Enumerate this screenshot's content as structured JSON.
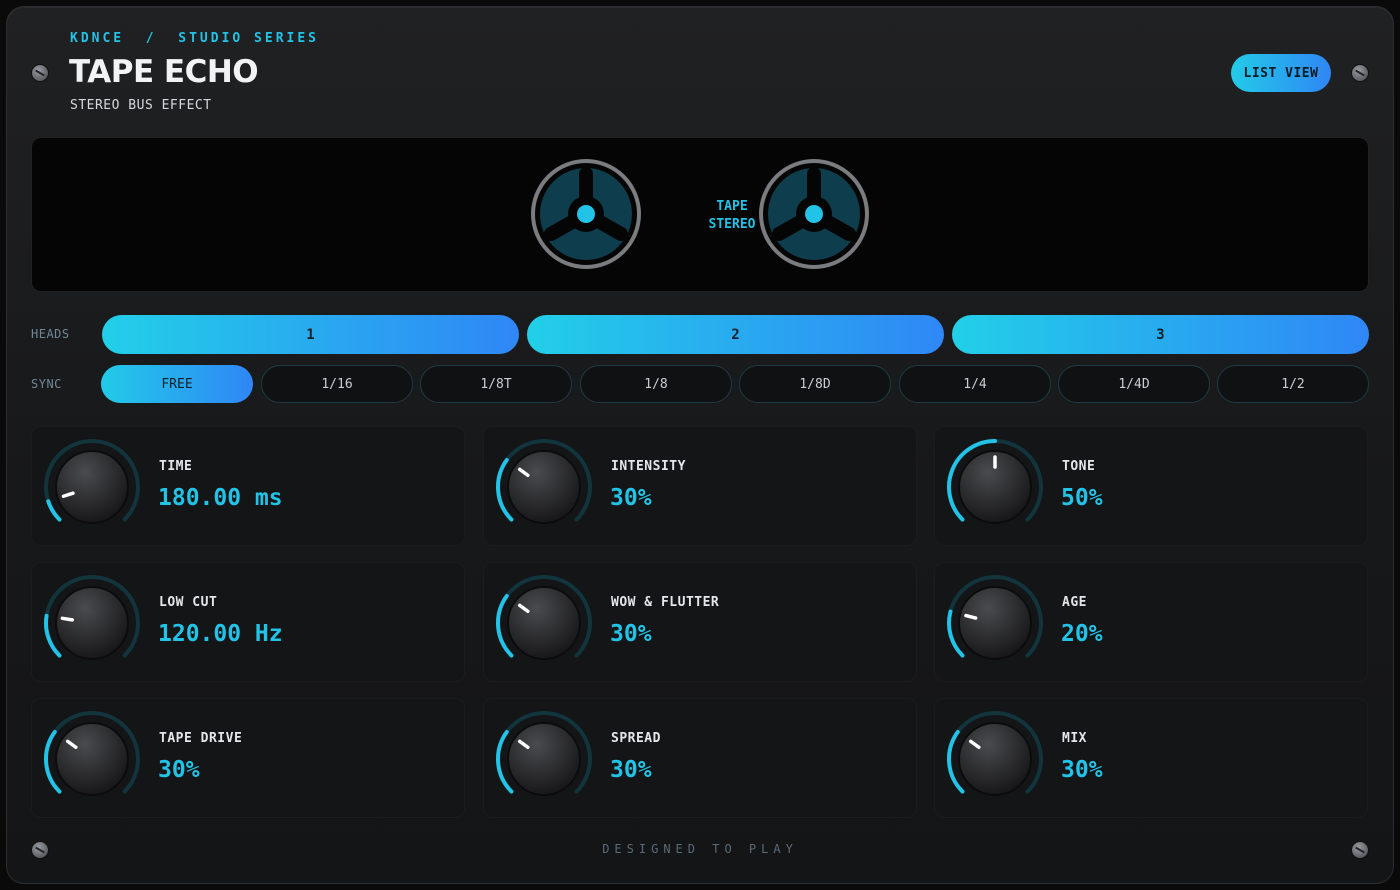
{
  "header": {
    "brand": "KDNCE  /  STUDIO SERIES",
    "title": "TAPE ECHO",
    "subtitle": "STEREO BUS EFFECT",
    "list_view_label": "LIST VIEW"
  },
  "display": {
    "tape_line1": "TAPE",
    "tape_line2": "STEREO"
  },
  "heads": {
    "label": "HEADS",
    "options": [
      "1",
      "2",
      "3"
    ]
  },
  "sync": {
    "label": "SYNC",
    "options": [
      "FREE",
      "1/16",
      "1/8T",
      "1/8",
      "1/8D",
      "1/4",
      "1/4D",
      "1/2"
    ],
    "selected": "FREE"
  },
  "params": [
    {
      "label": "TIME",
      "value": "180.00 ms",
      "level": 0.1
    },
    {
      "label": "INTENSITY",
      "value": "30%",
      "level": 0.3
    },
    {
      "label": "TONE",
      "value": "50%",
      "level": 0.5
    },
    {
      "label": "LOW CUT",
      "value": "120.00 Hz",
      "level": 0.2
    },
    {
      "label": "WOW & FLUTTER",
      "value": "30%",
      "level": 0.3
    },
    {
      "label": "AGE",
      "value": "20%",
      "level": 0.22
    },
    {
      "label": "TAPE DRIVE",
      "value": "30%",
      "level": 0.3
    },
    {
      "label": "SPREAD",
      "value": "30%",
      "level": 0.3
    },
    {
      "label": "MIX",
      "value": "30%",
      "level": 0.3
    }
  ],
  "footer": "DESIGNED TO PLAY",
  "colors": {
    "accent": "#22c3e6",
    "accent_gradient_end": "#2f86f5",
    "track": "#12343d",
    "panel": "#141517"
  }
}
